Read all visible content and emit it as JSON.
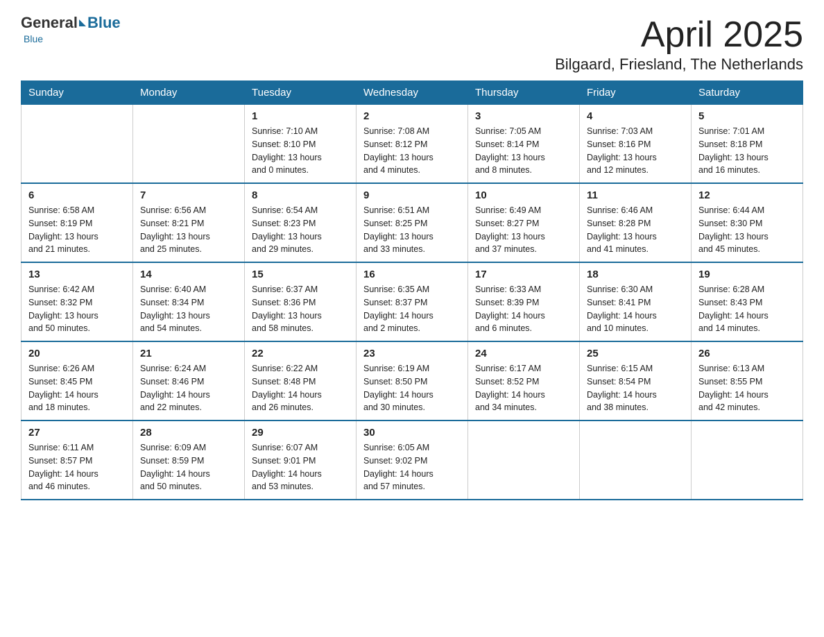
{
  "logo": {
    "general": "General",
    "blue": "Blue",
    "subtitle": "Blue"
  },
  "title": "April 2025",
  "subtitle": "Bilgaard, Friesland, The Netherlands",
  "headers": [
    "Sunday",
    "Monday",
    "Tuesday",
    "Wednesday",
    "Thursday",
    "Friday",
    "Saturday"
  ],
  "weeks": [
    [
      {
        "day": "",
        "info": ""
      },
      {
        "day": "",
        "info": ""
      },
      {
        "day": "1",
        "info": "Sunrise: 7:10 AM\nSunset: 8:10 PM\nDaylight: 13 hours\nand 0 minutes."
      },
      {
        "day": "2",
        "info": "Sunrise: 7:08 AM\nSunset: 8:12 PM\nDaylight: 13 hours\nand 4 minutes."
      },
      {
        "day": "3",
        "info": "Sunrise: 7:05 AM\nSunset: 8:14 PM\nDaylight: 13 hours\nand 8 minutes."
      },
      {
        "day": "4",
        "info": "Sunrise: 7:03 AM\nSunset: 8:16 PM\nDaylight: 13 hours\nand 12 minutes."
      },
      {
        "day": "5",
        "info": "Sunrise: 7:01 AM\nSunset: 8:18 PM\nDaylight: 13 hours\nand 16 minutes."
      }
    ],
    [
      {
        "day": "6",
        "info": "Sunrise: 6:58 AM\nSunset: 8:19 PM\nDaylight: 13 hours\nand 21 minutes."
      },
      {
        "day": "7",
        "info": "Sunrise: 6:56 AM\nSunset: 8:21 PM\nDaylight: 13 hours\nand 25 minutes."
      },
      {
        "day": "8",
        "info": "Sunrise: 6:54 AM\nSunset: 8:23 PM\nDaylight: 13 hours\nand 29 minutes."
      },
      {
        "day": "9",
        "info": "Sunrise: 6:51 AM\nSunset: 8:25 PM\nDaylight: 13 hours\nand 33 minutes."
      },
      {
        "day": "10",
        "info": "Sunrise: 6:49 AM\nSunset: 8:27 PM\nDaylight: 13 hours\nand 37 minutes."
      },
      {
        "day": "11",
        "info": "Sunrise: 6:46 AM\nSunset: 8:28 PM\nDaylight: 13 hours\nand 41 minutes."
      },
      {
        "day": "12",
        "info": "Sunrise: 6:44 AM\nSunset: 8:30 PM\nDaylight: 13 hours\nand 45 minutes."
      }
    ],
    [
      {
        "day": "13",
        "info": "Sunrise: 6:42 AM\nSunset: 8:32 PM\nDaylight: 13 hours\nand 50 minutes."
      },
      {
        "day": "14",
        "info": "Sunrise: 6:40 AM\nSunset: 8:34 PM\nDaylight: 13 hours\nand 54 minutes."
      },
      {
        "day": "15",
        "info": "Sunrise: 6:37 AM\nSunset: 8:36 PM\nDaylight: 13 hours\nand 58 minutes."
      },
      {
        "day": "16",
        "info": "Sunrise: 6:35 AM\nSunset: 8:37 PM\nDaylight: 14 hours\nand 2 minutes."
      },
      {
        "day": "17",
        "info": "Sunrise: 6:33 AM\nSunset: 8:39 PM\nDaylight: 14 hours\nand 6 minutes."
      },
      {
        "day": "18",
        "info": "Sunrise: 6:30 AM\nSunset: 8:41 PM\nDaylight: 14 hours\nand 10 minutes."
      },
      {
        "day": "19",
        "info": "Sunrise: 6:28 AM\nSunset: 8:43 PM\nDaylight: 14 hours\nand 14 minutes."
      }
    ],
    [
      {
        "day": "20",
        "info": "Sunrise: 6:26 AM\nSunset: 8:45 PM\nDaylight: 14 hours\nand 18 minutes."
      },
      {
        "day": "21",
        "info": "Sunrise: 6:24 AM\nSunset: 8:46 PM\nDaylight: 14 hours\nand 22 minutes."
      },
      {
        "day": "22",
        "info": "Sunrise: 6:22 AM\nSunset: 8:48 PM\nDaylight: 14 hours\nand 26 minutes."
      },
      {
        "day": "23",
        "info": "Sunrise: 6:19 AM\nSunset: 8:50 PM\nDaylight: 14 hours\nand 30 minutes."
      },
      {
        "day": "24",
        "info": "Sunrise: 6:17 AM\nSunset: 8:52 PM\nDaylight: 14 hours\nand 34 minutes."
      },
      {
        "day": "25",
        "info": "Sunrise: 6:15 AM\nSunset: 8:54 PM\nDaylight: 14 hours\nand 38 minutes."
      },
      {
        "day": "26",
        "info": "Sunrise: 6:13 AM\nSunset: 8:55 PM\nDaylight: 14 hours\nand 42 minutes."
      }
    ],
    [
      {
        "day": "27",
        "info": "Sunrise: 6:11 AM\nSunset: 8:57 PM\nDaylight: 14 hours\nand 46 minutes."
      },
      {
        "day": "28",
        "info": "Sunrise: 6:09 AM\nSunset: 8:59 PM\nDaylight: 14 hours\nand 50 minutes."
      },
      {
        "day": "29",
        "info": "Sunrise: 6:07 AM\nSunset: 9:01 PM\nDaylight: 14 hours\nand 53 minutes."
      },
      {
        "day": "30",
        "info": "Sunrise: 6:05 AM\nSunset: 9:02 PM\nDaylight: 14 hours\nand 57 minutes."
      },
      {
        "day": "",
        "info": ""
      },
      {
        "day": "",
        "info": ""
      },
      {
        "day": "",
        "info": ""
      }
    ]
  ]
}
